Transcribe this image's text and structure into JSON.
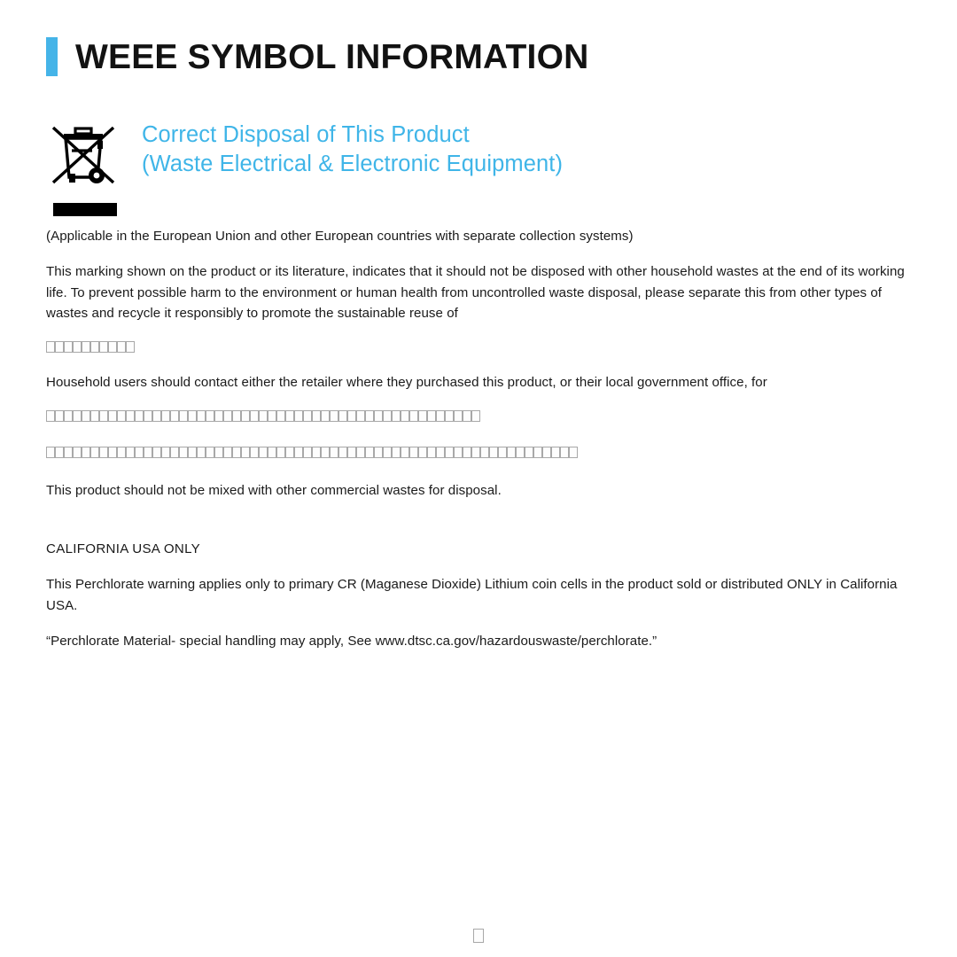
{
  "page": {
    "title": "WEEE SYMBOL INFORMATION",
    "accent_color": "#45b4e8",
    "heading_color": "#3fb5e8"
  },
  "section": {
    "icon_name": "weee-crossed-out-wheelie-bin-icon",
    "heading_line_1": "Correct Disposal of This Product",
    "heading_line_2": "(Waste Electrical & Electronic Equipment)"
  },
  "body": {
    "applicability": "(Applicable in the European Union and other European countries with separate collection systems)",
    "marking_paragraph": "This marking shown on the product or its literature, indicates that it should not be disposed with other household wastes at the end of its working life. To prevent possible harm to the environment or human health from uncontrolled waste disposal, please separate this from other types of wastes and recycle it responsibly to promote the sustainable reuse of",
    "marking_paragraph_missing_glyphs": 10,
    "household_paragraph": "Household users should contact either the retailer where they purchased this product, or their local government office, for",
    "household_paragraph_missing_glyphs": 49,
    "unrendered_paragraph_missing_glyphs": 60,
    "commercial_waste": "This product should not be mixed with other commercial wastes for disposal."
  },
  "california": {
    "heading": "CALIFORNIA USA ONLY",
    "perchlorate_paragraph": "This Perchlorate warning applies only to primary CR (Maganese Dioxide) Lithium coin cells in the product sold or distributed ONLY in California USA.",
    "perchlorate_quote": "“Perchlorate Material- special handling may apply, See www.dtsc.ca.gov/hazardouswaste/perchlorate.”"
  },
  "footer": {
    "page_marker_missing_glyphs": 1
  }
}
